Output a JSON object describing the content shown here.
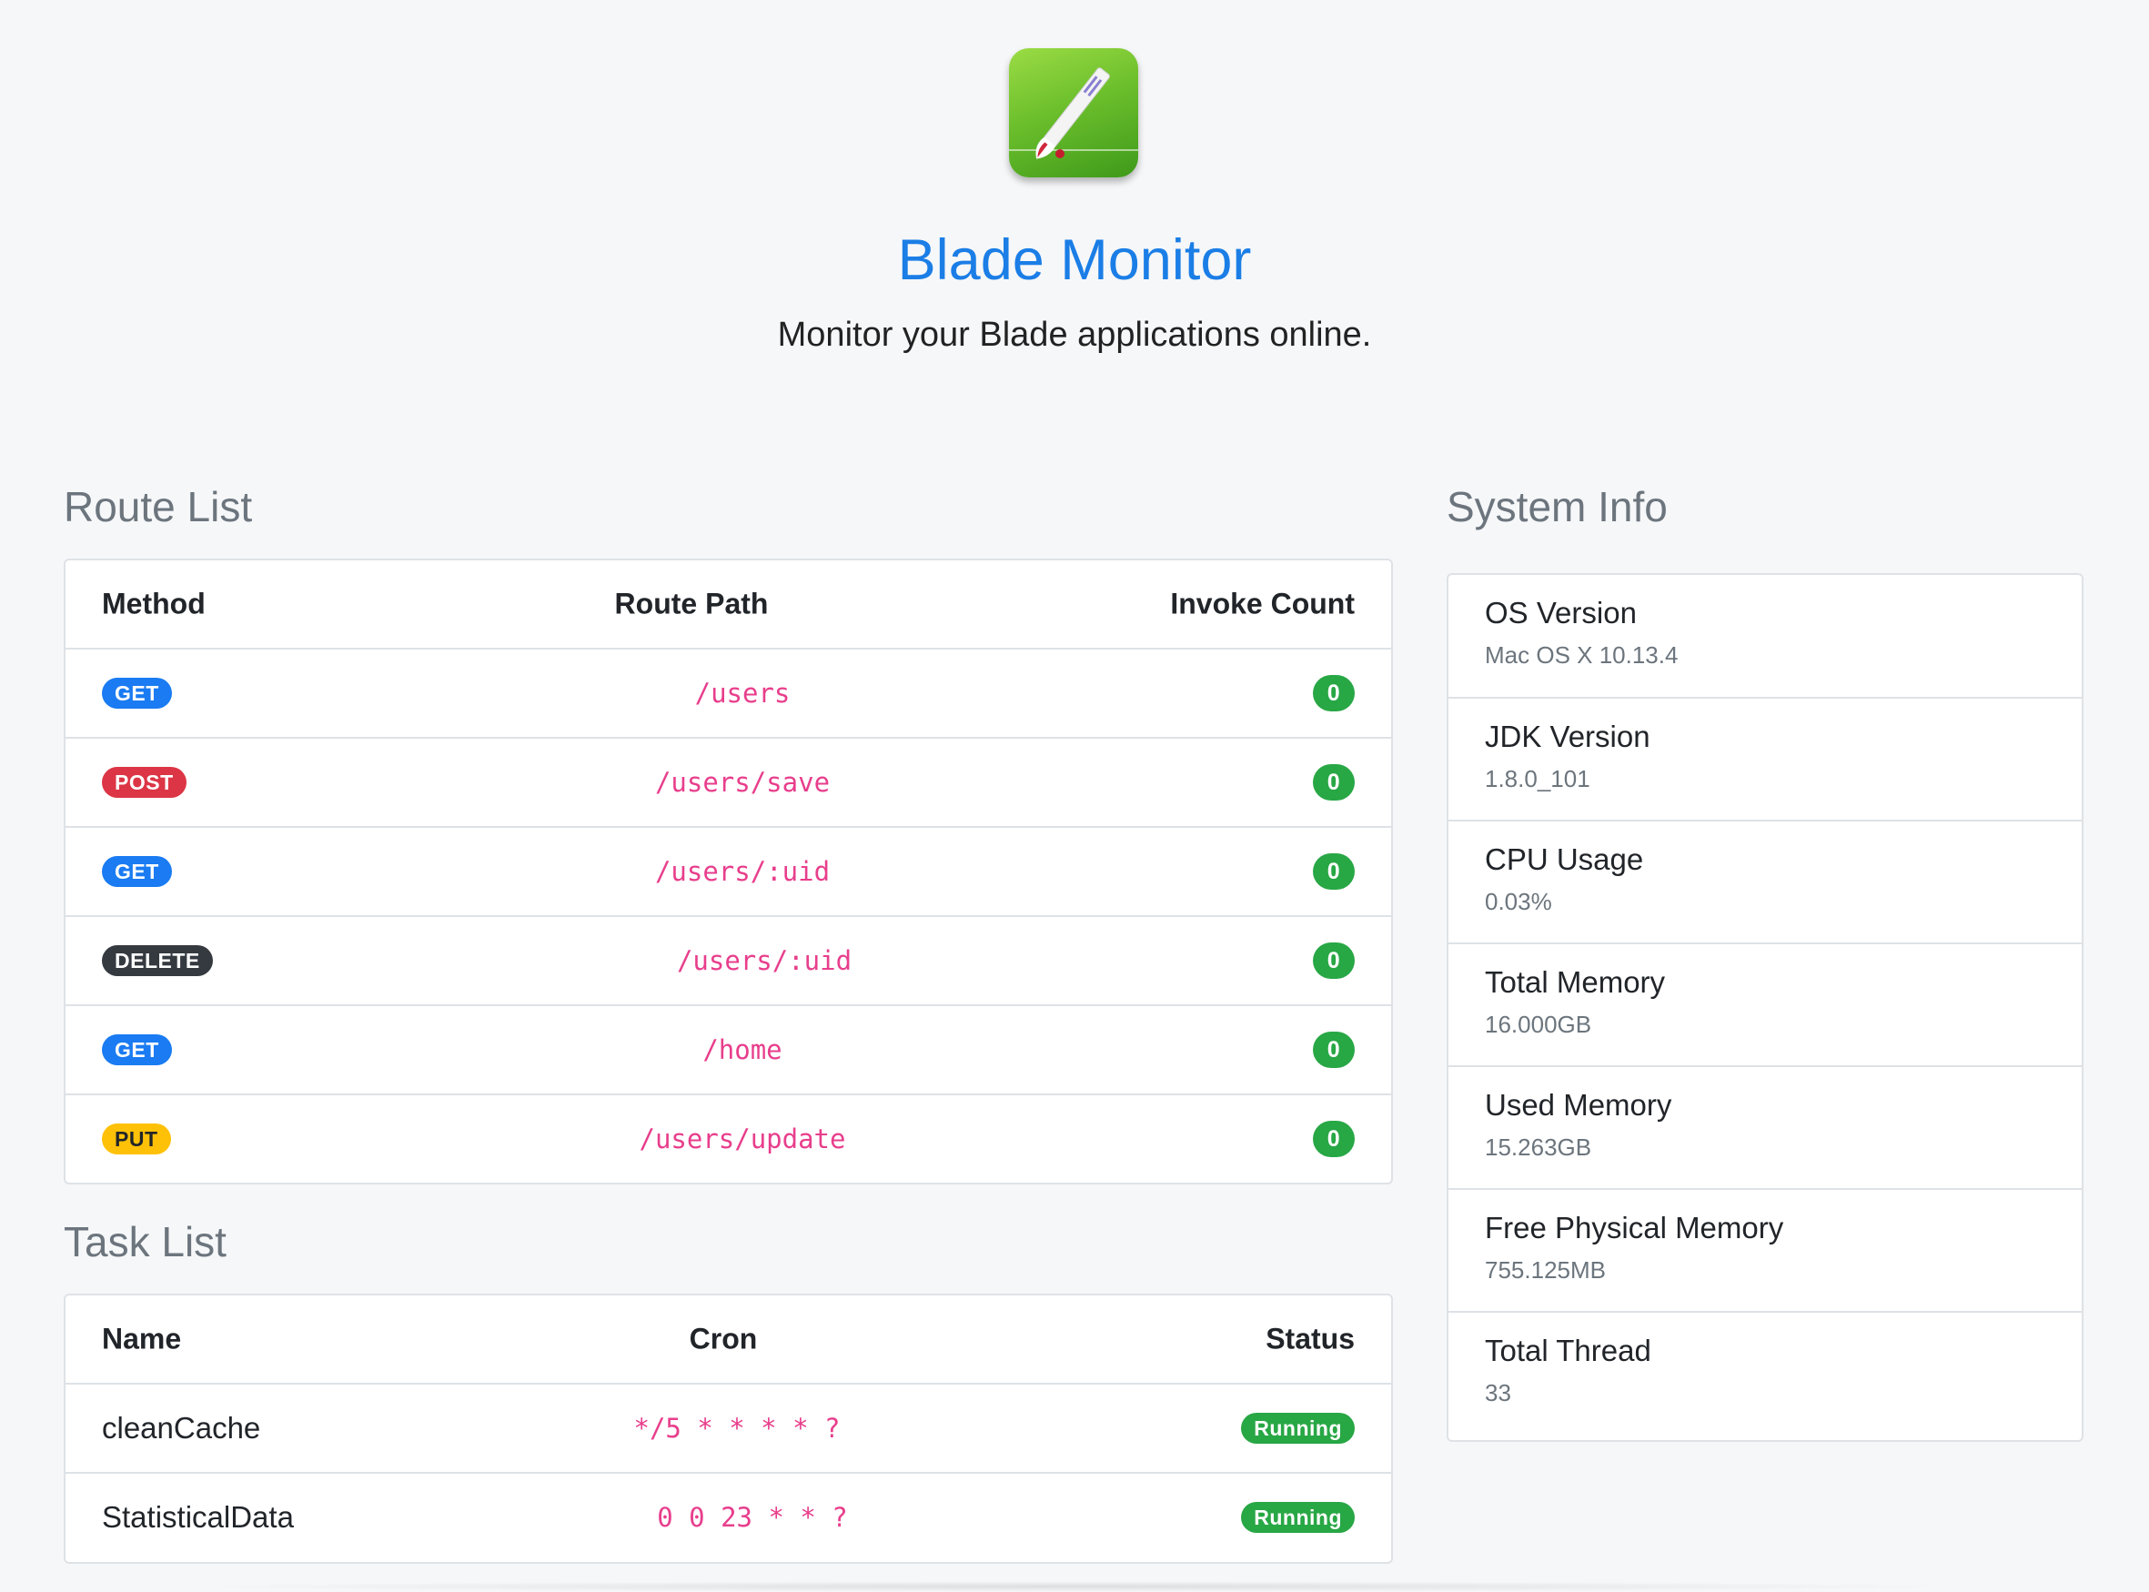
{
  "header": {
    "logo_icon": "blade-scalpel-logo",
    "title": "Blade Monitor",
    "subtitle": "Monitor your Blade applications online."
  },
  "routes": {
    "title": "Route List",
    "columns": [
      "Method",
      "Route Path",
      "Invoke Count"
    ],
    "rows": [
      {
        "method": "GET",
        "path": "/users",
        "count": "0"
      },
      {
        "method": "POST",
        "path": "/users/save",
        "count": "0"
      },
      {
        "method": "GET",
        "path": "/users/:uid",
        "count": "0"
      },
      {
        "method": "DELETE",
        "path": "/users/:uid",
        "count": "0"
      },
      {
        "method": "GET",
        "path": "/home",
        "count": "0"
      },
      {
        "method": "PUT",
        "path": "/users/update",
        "count": "0"
      }
    ]
  },
  "tasks": {
    "title": "Task List",
    "columns": [
      "Name",
      "Cron",
      "Status"
    ],
    "rows": [
      {
        "name": "cleanCache",
        "cron": "*/5 * * * * ?",
        "status": "Running"
      },
      {
        "name": "StatisticalData",
        "cron": "0 0 23 * * ?",
        "status": "Running"
      }
    ]
  },
  "system": {
    "title": "System Info",
    "items": [
      {
        "label": "OS Version",
        "value": "Mac OS X 10.13.4"
      },
      {
        "label": "JDK Version",
        "value": "1.8.0_101"
      },
      {
        "label": "CPU Usage",
        "value": "0.03%"
      },
      {
        "label": "Total Memory",
        "value": "16.000GB"
      },
      {
        "label": "Used Memory",
        "value": "15.263GB"
      },
      {
        "label": "Free Physical Memory",
        "value": "755.125MB"
      },
      {
        "label": "Total Thread",
        "value": "33"
      }
    ]
  },
  "colors": {
    "accent": "#1b7ee6",
    "get": "#1a7bf2",
    "post": "#dc3545",
    "delete": "#343a40",
    "put": "#ffc107",
    "success": "#28a745",
    "code": "#e83e8c"
  }
}
